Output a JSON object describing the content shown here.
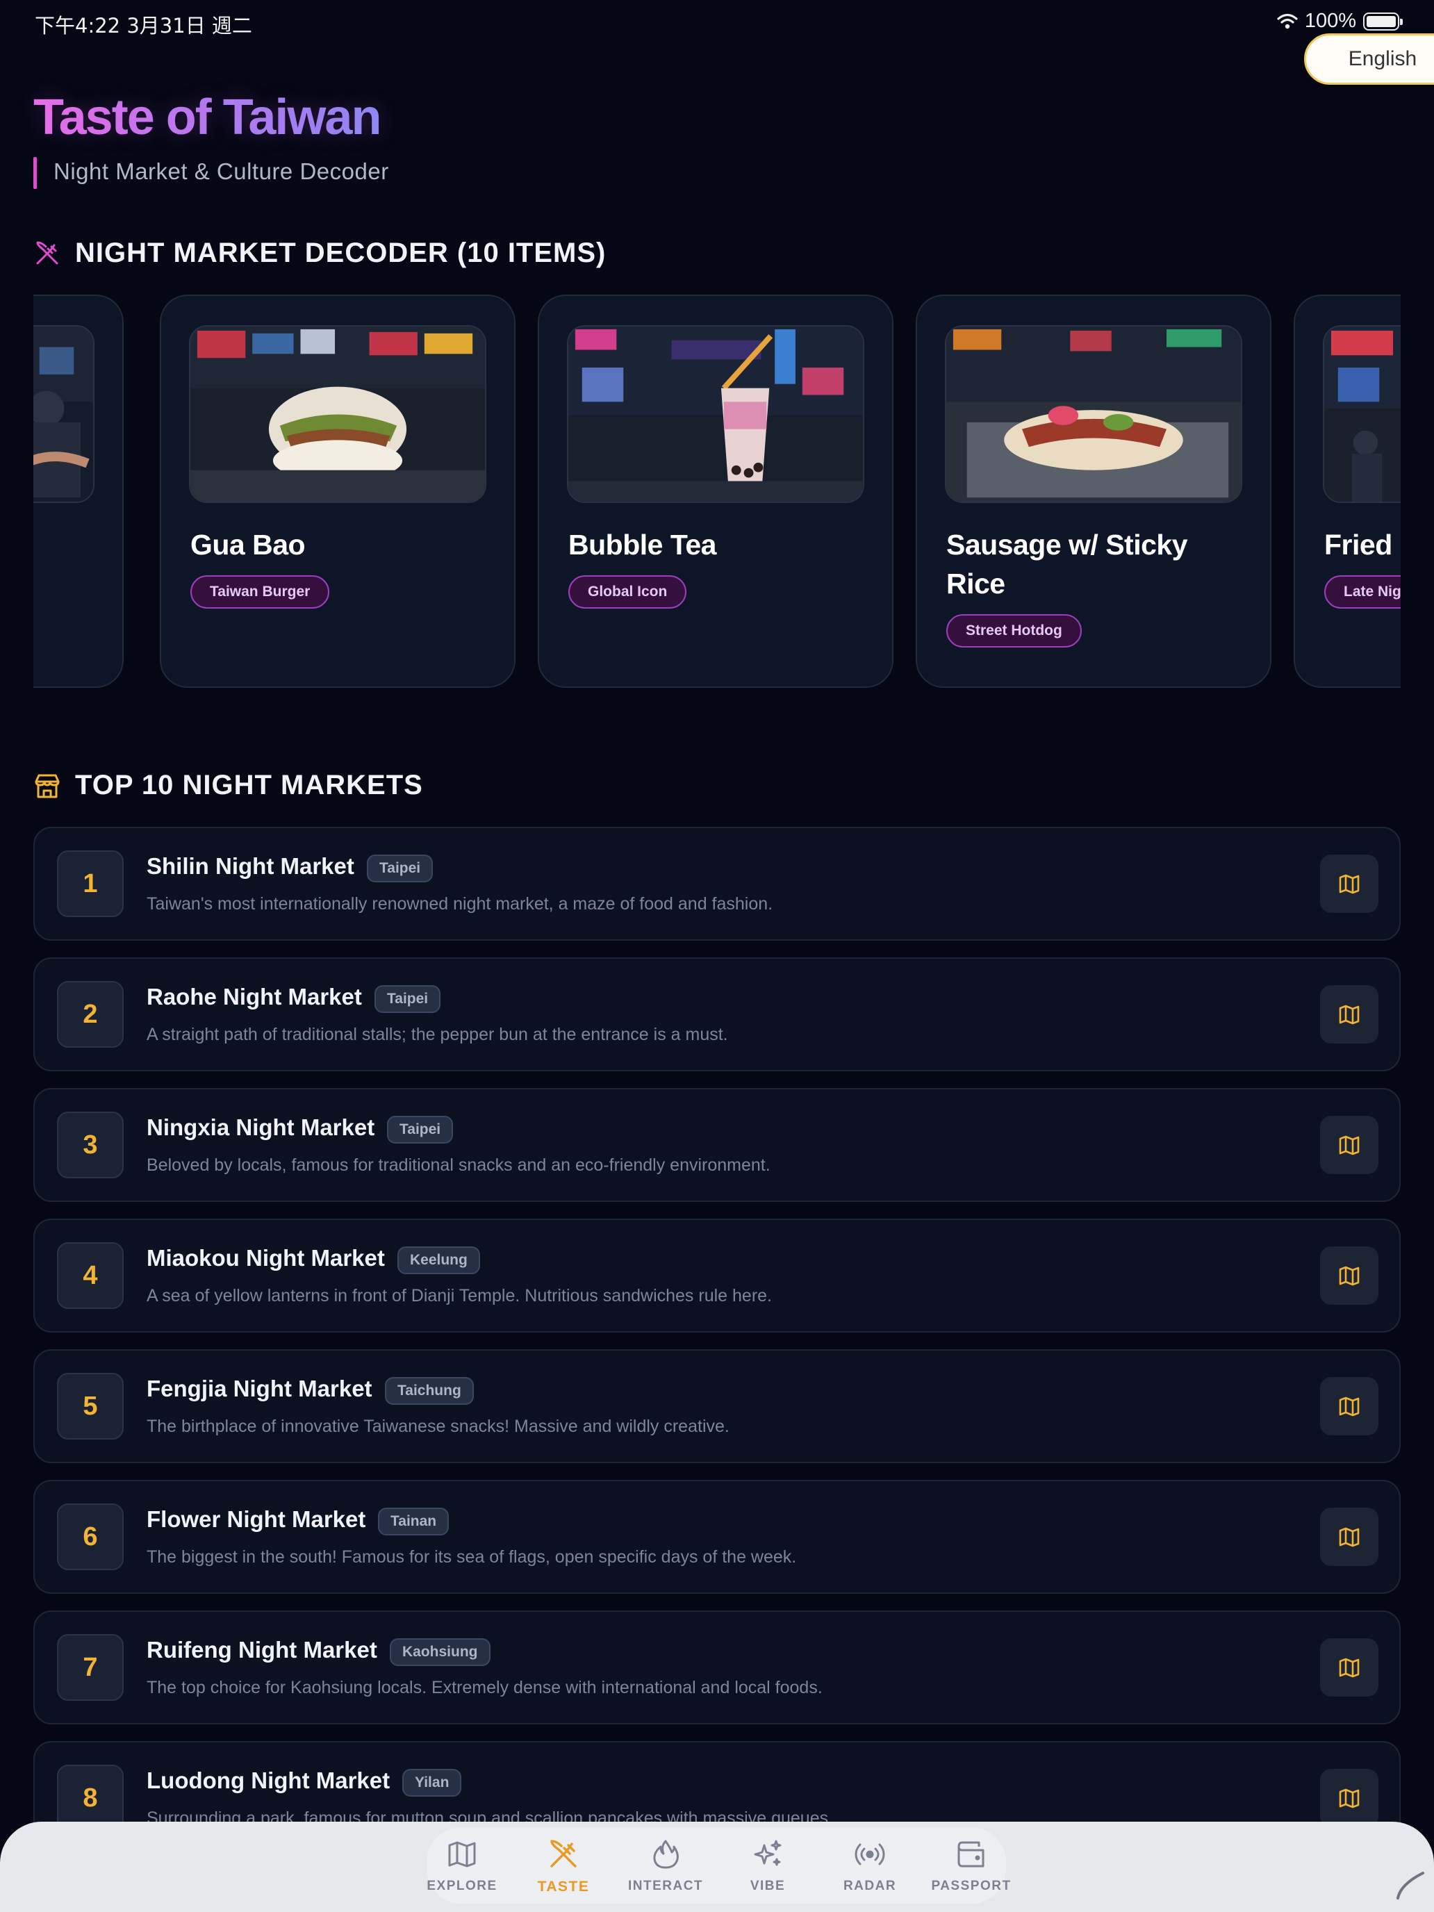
{
  "status_bar": {
    "time": "下午4:22   3月31日 週二",
    "battery": "100%"
  },
  "language_button": "English",
  "header": {
    "title": "Taste of Taiwan",
    "subtitle": "Night Market & Culture Decoder"
  },
  "decoder": {
    "heading": "NIGHT MARKET DECODER (10 ITEMS)",
    "items": [
      {
        "name": "",
        "tag": ""
      },
      {
        "name": "Gua Bao",
        "tag": "Taiwan Burger"
      },
      {
        "name": "Bubble Tea",
        "tag": "Global Icon"
      },
      {
        "name": "Sausage w/ Sticky Rice",
        "tag": "Street Hotdog"
      },
      {
        "name": "Fried C",
        "tag": "Late Nig"
      }
    ]
  },
  "markets": {
    "heading": "TOP 10 NIGHT MARKETS",
    "items": [
      {
        "rank": "1",
        "name": "Shilin Night Market",
        "city": "Taipei",
        "desc": "Taiwan's most internationally renowned night market, a maze of food and fashion."
      },
      {
        "rank": "2",
        "name": "Raohe Night Market",
        "city": "Taipei",
        "desc": "A straight path of traditional stalls; the pepper bun at the entrance is a must."
      },
      {
        "rank": "3",
        "name": "Ningxia Night Market",
        "city": "Taipei",
        "desc": "Beloved by locals, famous for traditional snacks and an eco-friendly environment."
      },
      {
        "rank": "4",
        "name": "Miaokou Night Market",
        "city": "Keelung",
        "desc": "A sea of yellow lanterns in front of Dianji Temple. Nutritious sandwiches rule here."
      },
      {
        "rank": "5",
        "name": "Fengjia Night Market",
        "city": "Taichung",
        "desc": "The birthplace of innovative Taiwanese snacks! Massive and wildly creative."
      },
      {
        "rank": "6",
        "name": "Flower Night Market",
        "city": "Tainan",
        "desc": "The biggest in the south! Famous for its sea of flags, open specific days of the week."
      },
      {
        "rank": "7",
        "name": "Ruifeng Night Market",
        "city": "Kaohsiung",
        "desc": "The top choice for Kaohsiung locals. Extremely dense with international and local foods."
      },
      {
        "rank": "8",
        "name": "Luodong Night Market",
        "city": "Yilan",
        "desc": "Surrounding a park, famous for mutton soup and scallion pancakes with massive queues."
      }
    ]
  },
  "tabs": [
    {
      "label": "EXPLORE",
      "icon": "map-icon",
      "active": false
    },
    {
      "label": "TASTE",
      "icon": "utensils-icon",
      "active": true
    },
    {
      "label": "INTERACT",
      "icon": "flame-icon",
      "active": false
    },
    {
      "label": "VIBE",
      "icon": "sparkles-icon",
      "active": false
    },
    {
      "label": "RADAR",
      "icon": "radar-icon",
      "active": false
    },
    {
      "label": "PASSPORT",
      "icon": "wallet-icon",
      "active": false
    }
  ],
  "colors": {
    "accent": "#f3b333",
    "tab_active": "#e99a25",
    "title_gradient_start": "#ec6ee8",
    "tag_border": "#9b3fc0"
  }
}
